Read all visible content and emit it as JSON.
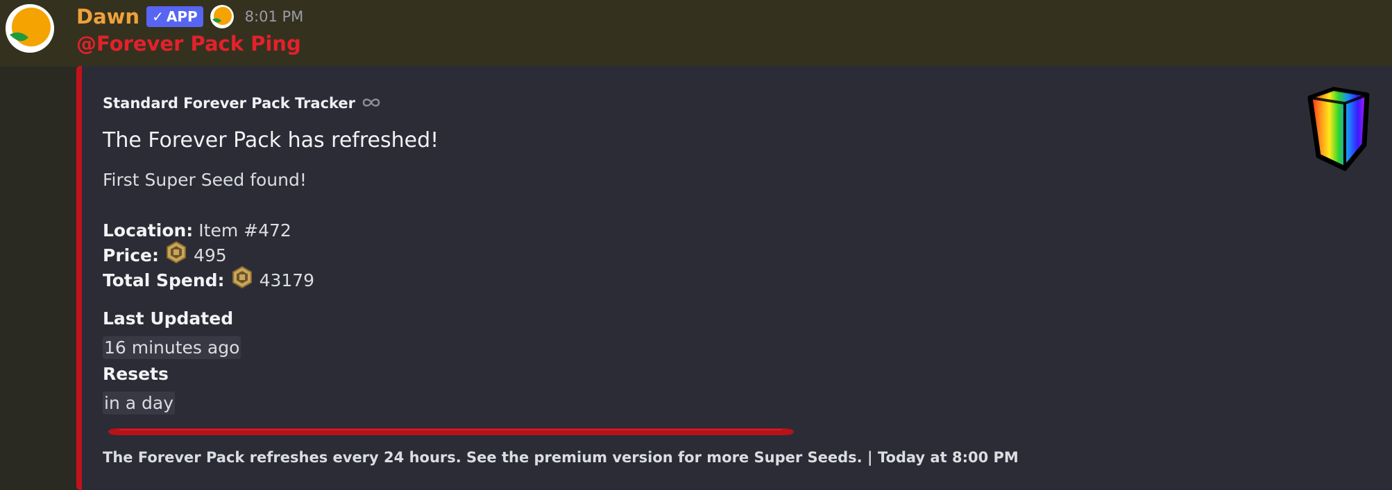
{
  "message": {
    "author": "Dawn",
    "app_badge": "APP",
    "timestamp": "8:01 PM",
    "mention": "@Forever Pack Ping"
  },
  "embed": {
    "author_name": "Standard Forever Pack Tracker",
    "title": "The Forever Pack has refreshed!",
    "description": "First Super Seed found!",
    "fields": {
      "location_label": "Location:",
      "location_value": "Item #472",
      "price_label": "Price:",
      "price_value": "495",
      "spend_label": "Total Spend:",
      "spend_value": "43179"
    },
    "last_updated_label": "Last Updated",
    "last_updated_value": "16 minutes ago",
    "resets_label": "Resets",
    "resets_value": "in a day",
    "footer": "The Forever Pack refreshes every 24 hours. See the premium version for more Super Seeds. | Today at 8:00 PM"
  },
  "icons": {
    "avatar": "orange-leaf-logo",
    "role": "orange-leaf-icon",
    "author_icon": "infinity-icon",
    "currency": "robux-coin-icon",
    "thumbnail": "rainbow-pack-icon"
  },
  "colors": {
    "author": "#f0a13a",
    "mention": "#e3212b",
    "embed_accent": "#c1121c",
    "app_badge": "#5865f2",
    "embed_bg": "#2b2c36"
  }
}
